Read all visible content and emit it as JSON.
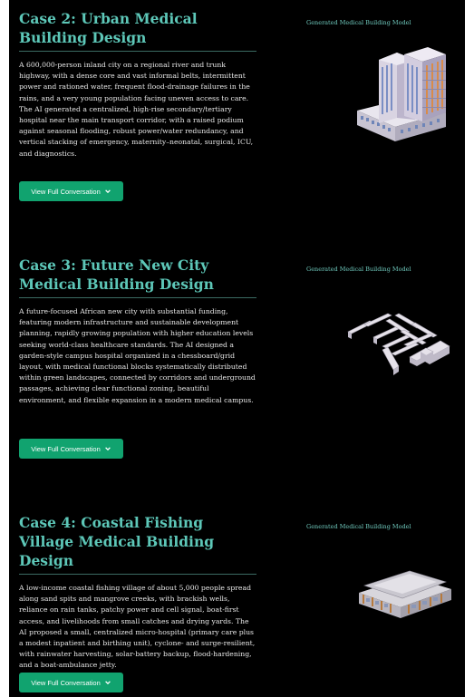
{
  "cases": [
    {
      "title": "Case 2: Urban Medical Building Design",
      "description": "A 600,000-person inland city on a regional river and trunk highway, with a dense core and vast informal belts, intermittent power and rationed water, frequent flood-drainage failures in the rains, and a very young population facing uneven access to care. The AI generated a centralized, high-rise secondary/tertiary hospital near the main transport corridor, with a raised podium against seasonal flooding, robust power/water redundancy, and vertical stacking of emergency, maternity–neonatal, surgical, ICU, and diagnostics.",
      "button_label": "View Full Conversation",
      "model_label": "Generated Medical Building Model"
    },
    {
      "title": "Case 3: Future New City Medical Building Design",
      "description": "A future-focused African new city with substantial funding, featuring modern infrastructure and sustainable development planning, rapidly growing population with higher education levels seeking world-class healthcare standards. The AI designed a garden-style campus hospital organized in a chessboard/grid layout, with medical functional blocks systematically distributed within green landscapes, connected by corridors and underground passages, achieving clear functional zoning, beautiful environment, and flexible expansion in a modern medical campus.",
      "button_label": "View Full Conversation",
      "model_label": "Generated Medical Building Model"
    },
    {
      "title": "Case 4: Coastal Fishing Village Medical Building Design",
      "description": "A low-income coastal fishing village of about 5,000 people spread along sand spits and mangrove creeks, with brackish wells, reliance on rain tanks, patchy power and cell signal, boat-first access, and livelihoods from small catches and drying yards. The AI proposed a small, centralized micro-hospital (primary care plus a modest inpatient and birthing unit), cyclone- and surge-resilient, with rainwater harvesting, solar-battery backup, flood-hardening, and a boat-ambulance jetty.",
      "button_label": "View Full Conversation",
      "model_label": "Generated Medical Building Model"
    }
  ],
  "icons": {
    "button": "chevron-down-icon"
  },
  "colors": {
    "title": "#5dc7b8",
    "button": "#11a36f",
    "background": "#000000"
  }
}
